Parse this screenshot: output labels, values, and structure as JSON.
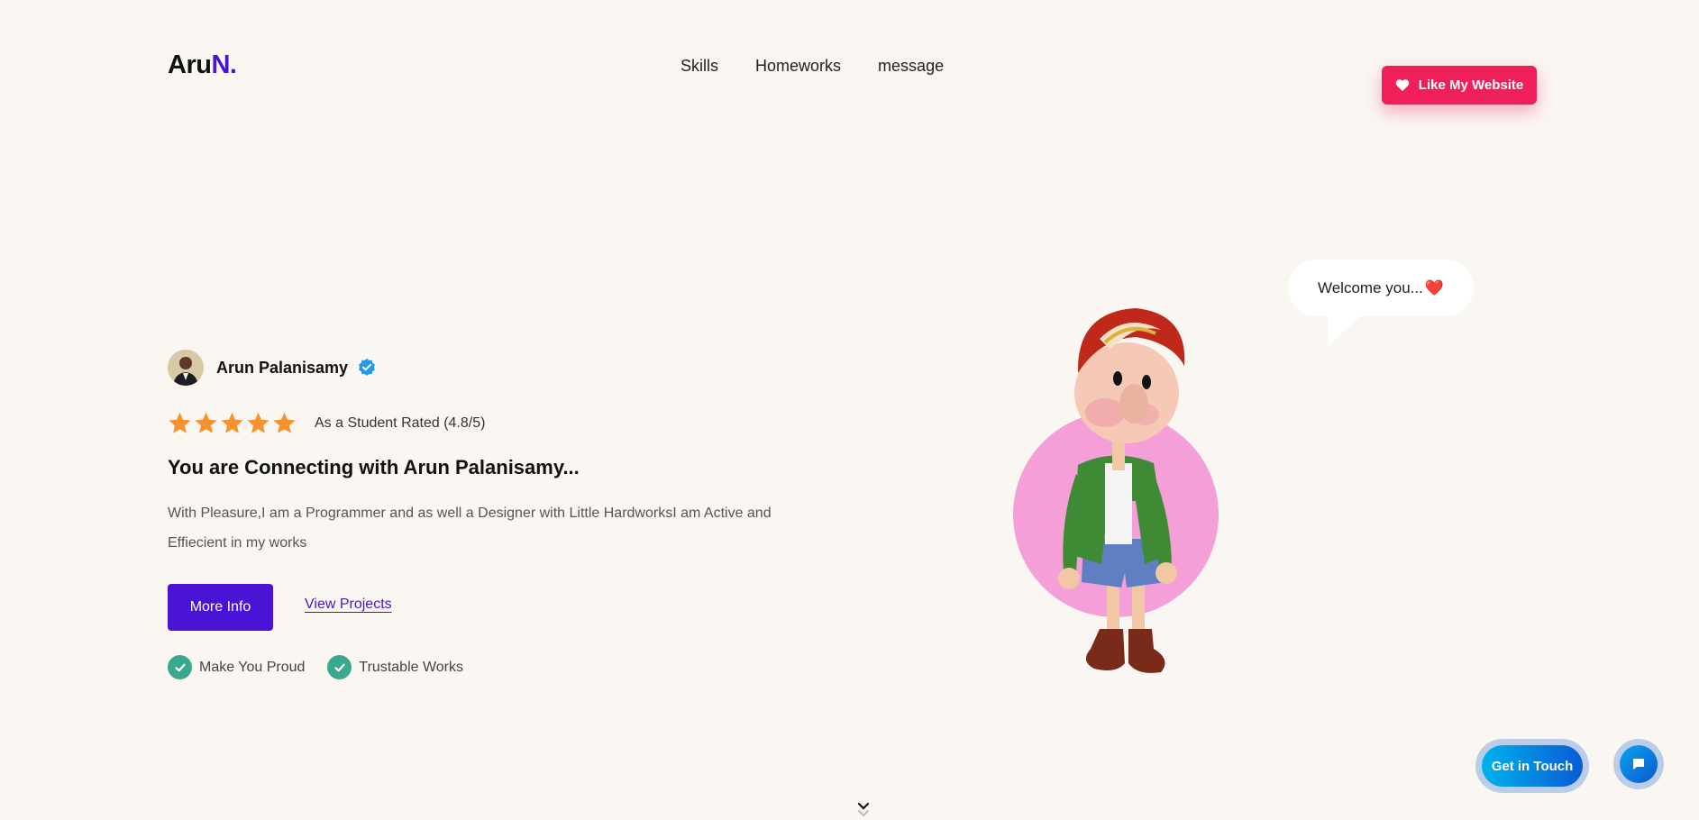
{
  "brand": {
    "text_main": "Aru",
    "text_accent": "N.",
    "accent_color": "#4a14d4"
  },
  "nav": {
    "items": [
      {
        "label": "Skills"
      },
      {
        "label": "Homeworks"
      },
      {
        "label": "message"
      }
    ]
  },
  "like_button": {
    "label": "Like My Website",
    "icon": "heart-icon",
    "color": "#ef1f5a"
  },
  "profile": {
    "name": "Arun Palanisamy",
    "avatar": "avatar",
    "badge_icon": "verified-badge-icon"
  },
  "rating": {
    "stars": 5,
    "text": "As a Student Rated (4.8/5)",
    "star_color": "#f7922e"
  },
  "hero": {
    "headline": "You are Connecting with Arun Palanisamy...",
    "description": "With Pleasure,I am a Programmer and as well a Designer with Little HardworksI am Active and Effiecient in my works",
    "primary_button": "More Info",
    "secondary_link": "View Projects"
  },
  "features": [
    {
      "label": "Make You Proud"
    },
    {
      "label": "Trustable Works"
    }
  ],
  "speech_bubble": {
    "text": "Welcome you...",
    "emoji": "❤️"
  },
  "illustration": {
    "subject": "cartoon boy in red cap",
    "circle_color": "#f59fd8"
  },
  "floating": {
    "get_in_touch": "Get in Touch",
    "chat_icon": "chat-icon"
  }
}
